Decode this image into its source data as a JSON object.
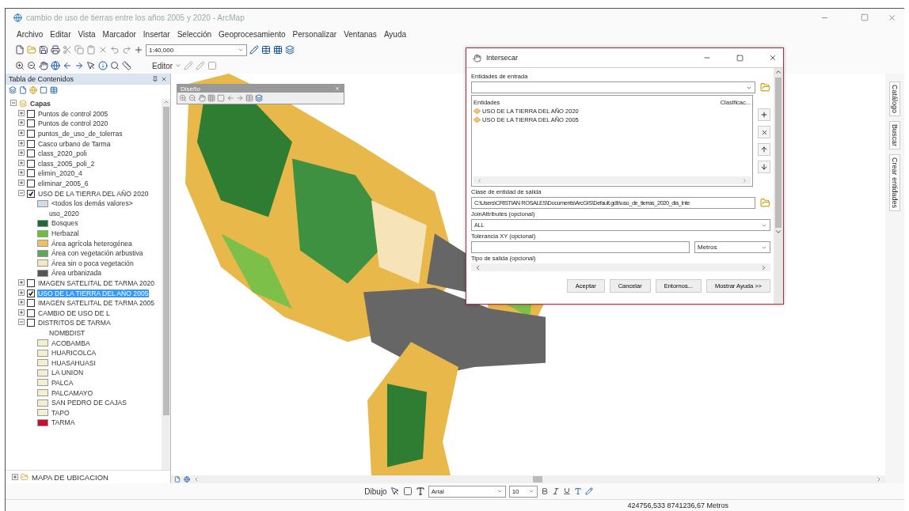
{
  "window": {
    "title": "cambio de uso de tierras entre los años 2005 y 2020 - ArcMap"
  },
  "menu": [
    "Archivo",
    "Editar",
    "Vista",
    "Marcador",
    "Insertar",
    "Selección",
    "Geoprocesamiento",
    "Personalizar",
    "Ventanas",
    "Ayuda"
  ],
  "toolbar": {
    "scale": "1:40,000",
    "editor": "Editor"
  },
  "toc": {
    "title": "Tabla de Contenidos",
    "group": "Capas",
    "group_expanded": true,
    "layers": [
      {
        "label": "Puntos de control 2005",
        "checked": false,
        "expanded": false,
        "selected": false
      },
      {
        "label": "Puntos de control 2020",
        "checked": false,
        "expanded": false,
        "selected": false
      },
      {
        "label": "puntos_de_uso_de_tolerras",
        "checked": false,
        "expanded": false,
        "selected": false
      },
      {
        "label": "Casco urbano de Tarma",
        "checked": false,
        "expanded": false,
        "selected": false
      },
      {
        "label": "class_2020_poli",
        "checked": false,
        "expanded": false,
        "selected": false
      },
      {
        "label": "class_2005_poli_2",
        "checked": false,
        "expanded": false,
        "selected": false
      },
      {
        "label": "elimin_2020_4",
        "checked": false,
        "expanded": false,
        "selected": false
      },
      {
        "label": "eliminar_2005_6",
        "checked": false,
        "expanded": false,
        "selected": false
      },
      {
        "label": "USO DE LA TIERRA DEL AÑO 2020",
        "checked": true,
        "expanded": true,
        "selected": false,
        "legend": [
          {
            "kind": "swatch",
            "label": "<todos los demás valores>",
            "color": "#cfdde8"
          },
          {
            "kind": "heading",
            "label": "uso_2020"
          },
          {
            "kind": "swatch",
            "label": "Bosques",
            "color": "#1e6b3a"
          },
          {
            "kind": "swatch",
            "label": "Herbazal",
            "color": "#6dbf3b"
          },
          {
            "kind": "swatch",
            "label": "Área agrícola heterogénea",
            "color": "#f0c060"
          },
          {
            "kind": "swatch",
            "label": "Área con vegetación arbustiva",
            "color": "#5fa85a"
          },
          {
            "kind": "swatch",
            "label": "Área sin o poca vegetación",
            "color": "#f7e6c0"
          },
          {
            "kind": "swatch",
            "label": "Área urbanizada",
            "color": "#555555"
          }
        ]
      },
      {
        "label": "IMAGEN SATELITAL DE TARMA 2020",
        "checked": false,
        "expanded": false,
        "selected": false
      },
      {
        "label": "USO DE LA TIERRA DEL AÑO 2005",
        "checked": true,
        "expanded": false,
        "selected": true
      },
      {
        "label": "IMAGEN SATELITAL DE TARMA 2005",
        "checked": false,
        "expanded": false,
        "selected": false
      },
      {
        "label": "CAMBIO DE USO DE L",
        "checked": false,
        "expanded": false,
        "selected": false
      },
      {
        "label": "DISTRITOS DE TARMA",
        "checked": false,
        "expanded": true,
        "selected": false,
        "legend": [
          {
            "kind": "heading",
            "label": "NOMBDIST"
          },
          {
            "kind": "swatch",
            "label": "ACOBAMBA",
            "color": "#f3efd0"
          },
          {
            "kind": "swatch",
            "label": "HUARICOLCA",
            "color": "#f3efd0"
          },
          {
            "kind": "swatch",
            "label": "HUASAHUASI",
            "color": "#f3efd0"
          },
          {
            "kind": "swatch",
            "label": "LA UNION",
            "color": "#f3efd0"
          },
          {
            "kind": "swatch",
            "label": "PALCA",
            "color": "#f3efd0"
          },
          {
            "kind": "swatch",
            "label": "PALCAMAYO",
            "color": "#f3efd0"
          },
          {
            "kind": "swatch",
            "label": "SAN PEDRO DE CAJAS",
            "color": "#f3efd0"
          },
          {
            "kind": "swatch",
            "label": "TAPO",
            "color": "#f3efd0"
          },
          {
            "kind": "swatch",
            "label": "TARMA",
            "color": "#c8102e"
          }
        ]
      }
    ],
    "bottom_group": "MAPA DE UBICACION",
    "bottom_group_expanded": false
  },
  "layout_toolbar": {
    "title": "Diseño"
  },
  "side_tabs": [
    "Catálogo",
    "Buscar",
    "Crear entidades"
  ],
  "dialog": {
    "title": "Intersecar",
    "input_label": "Entidades de entrada",
    "list_columns": [
      "Entidades",
      "Clasificac..."
    ],
    "list_items": [
      "USO DE LA TIERRA DEL AÑO 2020",
      "USO DE LA TIERRA DEL AÑO 2005"
    ],
    "output_label": "Clase de entidad de salida",
    "output_value": "C:\\Users\\CRISTIAN ROSALES\\Documents\\ArcGIS\\Default.gdb\\uso_de_tierras_2020_dia_Inte",
    "join_label": "JoinAttributes (opcional)",
    "join_value": "ALL",
    "tolerance_label": "Tolerancia XY (opcional)",
    "tolerance_unit": "Metros",
    "type_label": "Tipo de salida (opcional)",
    "buttons": [
      "Aceptar",
      "Cancelar",
      "Entornos...",
      "Mostrar Ayuda >>"
    ]
  },
  "draw_toolbar": {
    "label": "Dibujo",
    "font": "Arial",
    "size": "10"
  },
  "status_bar": {
    "coordinates": "424756,533  8741236,67 Metros"
  }
}
